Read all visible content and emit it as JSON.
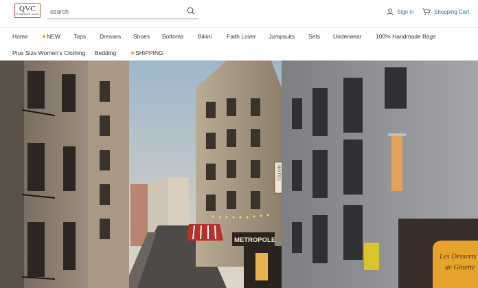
{
  "logo": {
    "main": "QVC",
    "sub": "CLEARANCE SALES"
  },
  "search": {
    "placeholder": "search"
  },
  "header": {
    "sign_in": "Sign in",
    "cart": "Shopping Cart"
  },
  "nav": {
    "home": "Home",
    "new": "NEW",
    "tops": "Tops",
    "dresses": "Dresses",
    "shoes": "Shoes",
    "bottoms": "Bottoms",
    "bikini": "Bikini",
    "faith_lover": "Faith Lover",
    "jumpsuits": "Jumpsuits",
    "sets": "Sets",
    "underwear": "Underwear",
    "handmade_bags": "100% Handmade Bags",
    "plus_size": "Plus Size Women's Clothing",
    "bedding": "Bedding",
    "shipping": "SHIPPING"
  },
  "hero": {
    "sign_hotel": "HOTEL",
    "sign_metropole": "METROPOLE",
    "cafe_sign_line1": "Les Desserts",
    "cafe_sign_line2": "de Ginette"
  },
  "colors": {
    "accent_link": "#2a6cb4",
    "logo_border": "#d9534f",
    "star": "#e9a800"
  }
}
